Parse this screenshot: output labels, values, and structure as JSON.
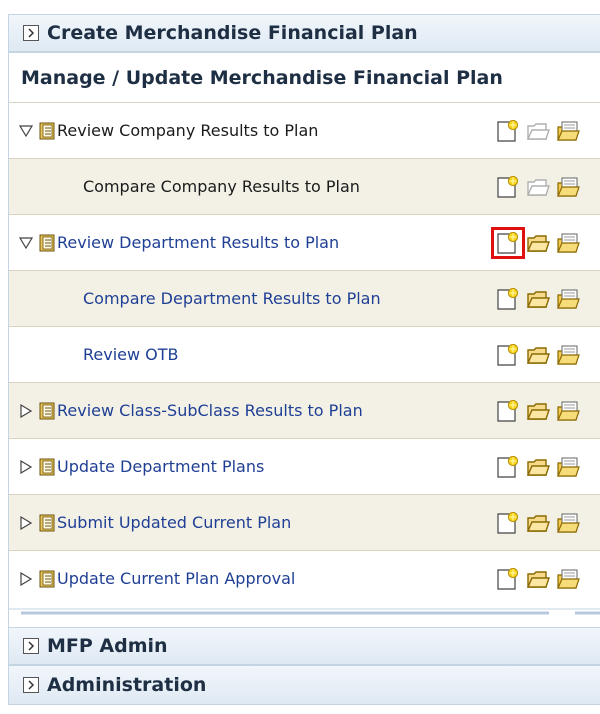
{
  "panels": {
    "create": "Create Merchandise Financial Plan",
    "manage": "Manage / Update Merchandise Financial Plan",
    "mfp_admin": "MFP Admin",
    "administration": "Administration"
  },
  "tasks": [
    {
      "label": "Review Company Results to Plan",
      "state": "expanded",
      "level": 0,
      "link": false
    },
    {
      "label": "Compare Company Results to Plan",
      "state": "leaf",
      "level": 1,
      "link": false
    },
    {
      "label": "Review Department Results to Plan",
      "state": "expanded",
      "level": 0,
      "link": true
    },
    {
      "label": "Compare Department Results to Plan",
      "state": "leaf",
      "level": 1,
      "link": true
    },
    {
      "label": "Review OTB",
      "state": "leaf",
      "level": 1,
      "link": true
    },
    {
      "label": "Review Class-SubClass Results to Plan",
      "state": "collapsed",
      "level": 0,
      "link": true
    },
    {
      "label": "Update Department Plans",
      "state": "collapsed",
      "level": 0,
      "link": true
    },
    {
      "label": "Submit Updated Current Plan",
      "state": "collapsed",
      "level": 0,
      "link": true
    },
    {
      "label": "Update Current Plan Approval",
      "state": "collapsed",
      "level": 0,
      "link": true
    }
  ],
  "icons": {
    "expanded": "triangle-down-outline",
    "collapsed": "triangle-right-outline",
    "new": "new-workbook-icon",
    "open": "open-workbook-icon",
    "folder": "open-folder-icon"
  },
  "colors": {
    "highlight": "#e01010",
    "link": "#1f3f95",
    "alt_row": "#f3f1e6"
  }
}
